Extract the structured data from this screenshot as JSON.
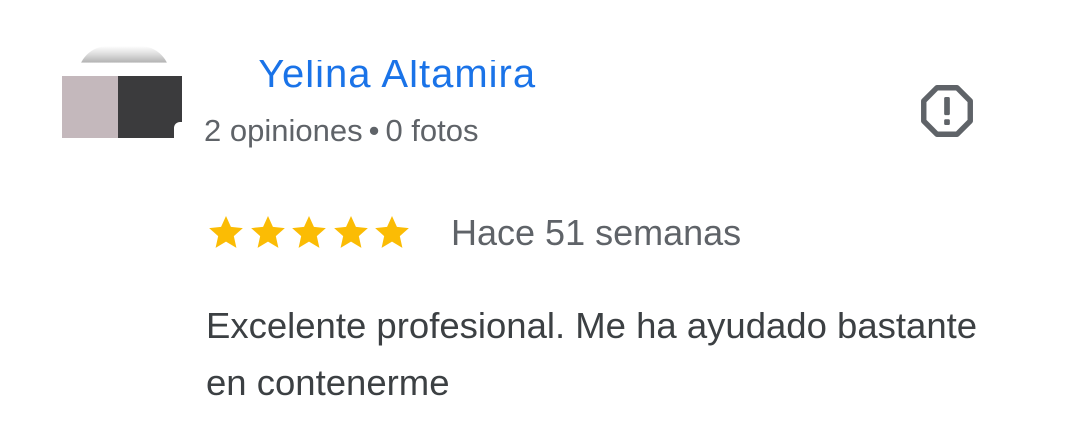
{
  "review": {
    "reviewer_name": "Yelina Altamira",
    "reviewer_meta": "2 opiniones",
    "reviewer_photos": "0 fotos",
    "separator": "•",
    "rating": 5,
    "rating_max": 5,
    "time_ago": "Hace 51 semanas",
    "text": "Excelente profesional. Me ha ayudado bastante en contenerme"
  },
  "icons": {
    "report": "report-flag-icon",
    "star": "star-icon"
  },
  "colors": {
    "star": "#fbbc04",
    "name_link": "#1a73e8",
    "secondary_text": "#5f6368",
    "body_text": "#3c4043",
    "icon": "#5f6368"
  }
}
